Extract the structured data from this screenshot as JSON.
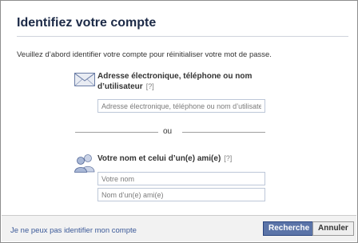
{
  "dialog": {
    "title": "Identifiez votre compte",
    "intro": "Veuillez d’abord identifier votre compte pour réinitialiser votre mot de passe."
  },
  "email_section": {
    "label_line1": "Adresse électronique, téléphone ou nom",
    "label_line2": "d’utilisateur",
    "help": "[?]",
    "placeholder": "Adresse électronique, téléphone ou nom d’utilisateur",
    "icon": "envelope-icon"
  },
  "separator": {
    "text": "ou"
  },
  "name_section": {
    "label": "Votre nom et celui d’un(e) ami(e)",
    "help": "[?]",
    "name_placeholder": "Votre nom",
    "friend_placeholder": "Nom d’un(e) ami(e)",
    "icon": "people-icon"
  },
  "footer": {
    "link": "Je ne peux pas identifier mon compte",
    "search_button": "Recherche",
    "cancel_button": "Annuler"
  },
  "colors": {
    "title": "#1c2a47",
    "link": "#3b5998",
    "primary_button": "#5b74a8",
    "footer_bg": "#f2f2f2"
  }
}
